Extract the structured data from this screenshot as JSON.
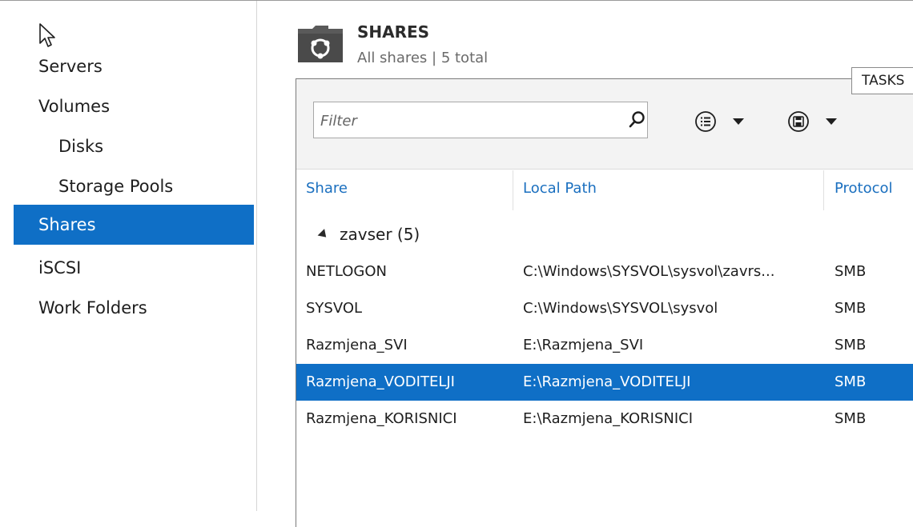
{
  "nav": {
    "items": [
      {
        "label": "Servers",
        "sub": false,
        "selected": false
      },
      {
        "label": "Volumes",
        "sub": false,
        "selected": false
      },
      {
        "label": "Disks",
        "sub": true,
        "selected": false
      },
      {
        "label": "Storage Pools",
        "sub": true,
        "selected": false
      },
      {
        "label": "Shares",
        "sub": false,
        "selected": true
      },
      {
        "label": "iSCSI",
        "sub": false,
        "selected": false
      },
      {
        "label": "Work Folders",
        "sub": false,
        "selected": false
      }
    ]
  },
  "header": {
    "title": "SHARES",
    "subtitle": "All shares | 5 total",
    "tasks_label": "TASKS"
  },
  "toolbar": {
    "filter_placeholder": "Filter",
    "icons": [
      "search-icon",
      "list-view-icon",
      "save-icon"
    ]
  },
  "table": {
    "columns": [
      "Share",
      "Local Path",
      "Protocol"
    ],
    "group_label": "zavser (5)",
    "rows": [
      {
        "share": "NETLOGON",
        "path": "C:\\Windows\\SYSVOL\\sysvol\\zavrs...",
        "protocol": "SMB",
        "selected": false
      },
      {
        "share": "SYSVOL",
        "path": "C:\\Windows\\SYSVOL\\sysvol",
        "protocol": "SMB",
        "selected": false
      },
      {
        "share": "Razmjena_SVI",
        "path": "E:\\Razmjena_SVI",
        "protocol": "SMB",
        "selected": false
      },
      {
        "share": "Razmjena_VODITELJI",
        "path": "E:\\Razmjena_VODITELJI",
        "protocol": "SMB",
        "selected": true
      },
      {
        "share": "Razmjena_KORISNICI",
        "path": "E:\\Razmjena_KORISNICI",
        "protocol": "SMB",
        "selected": false
      }
    ]
  },
  "colors": {
    "accent": "#0f6fc6",
    "link": "#1a6fbf"
  }
}
